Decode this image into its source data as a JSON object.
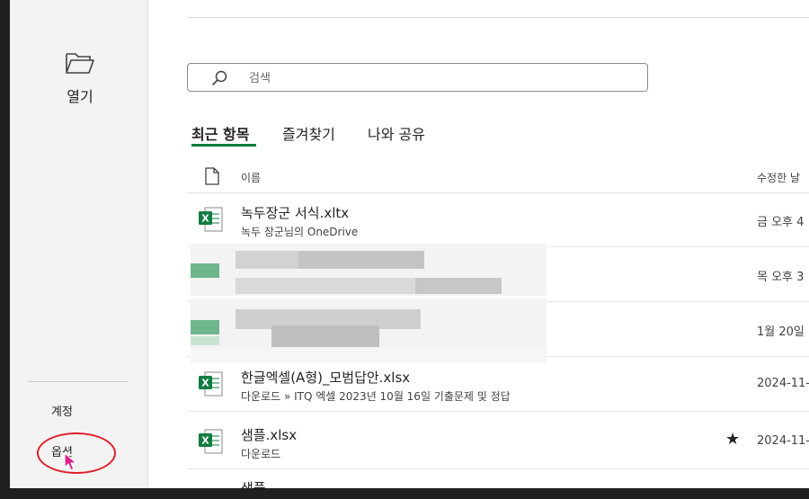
{
  "sidebar": {
    "open_label": "열기",
    "account_label": "계정",
    "options_label": "옵션"
  },
  "search": {
    "placeholder": "검색",
    "icon": "search-icon"
  },
  "tabs": [
    {
      "label": "최근 항목",
      "active": true
    },
    {
      "label": "즐겨찾기",
      "active": false
    },
    {
      "label": "나와 공유",
      "active": false
    }
  ],
  "list": {
    "header_name": "이름",
    "header_date": "수정한 날",
    "files": [
      {
        "title": "녹두장군 서식.xltx",
        "location": "녹두 장군님의 OneDrive",
        "date": "금 오후 4",
        "pinned": false,
        "blurred": false
      },
      {
        "title": "",
        "location": "",
        "date": "목 오후 3",
        "pinned": false,
        "blurred": true
      },
      {
        "title": "",
        "location": "",
        "date": "1월 20일",
        "pinned": false,
        "blurred": true
      },
      {
        "title": "한글엑셀(A형)_모범답안.xlsx",
        "location": "다운로드 » ITQ 엑셀 2023년 10월 16일 기출문제 및 정답",
        "date": "2024-11-",
        "pinned": false,
        "blurred": false
      },
      {
        "title": "샘플.xlsx",
        "location": "다운로드",
        "date": "2024-11-",
        "pinned": true,
        "blurred": false
      }
    ],
    "partial_next_title": "샘플"
  },
  "colors": {
    "excel_green": "#107c41",
    "annotation_red": "#e0202a",
    "cursor_magenta": "#e0208a"
  }
}
